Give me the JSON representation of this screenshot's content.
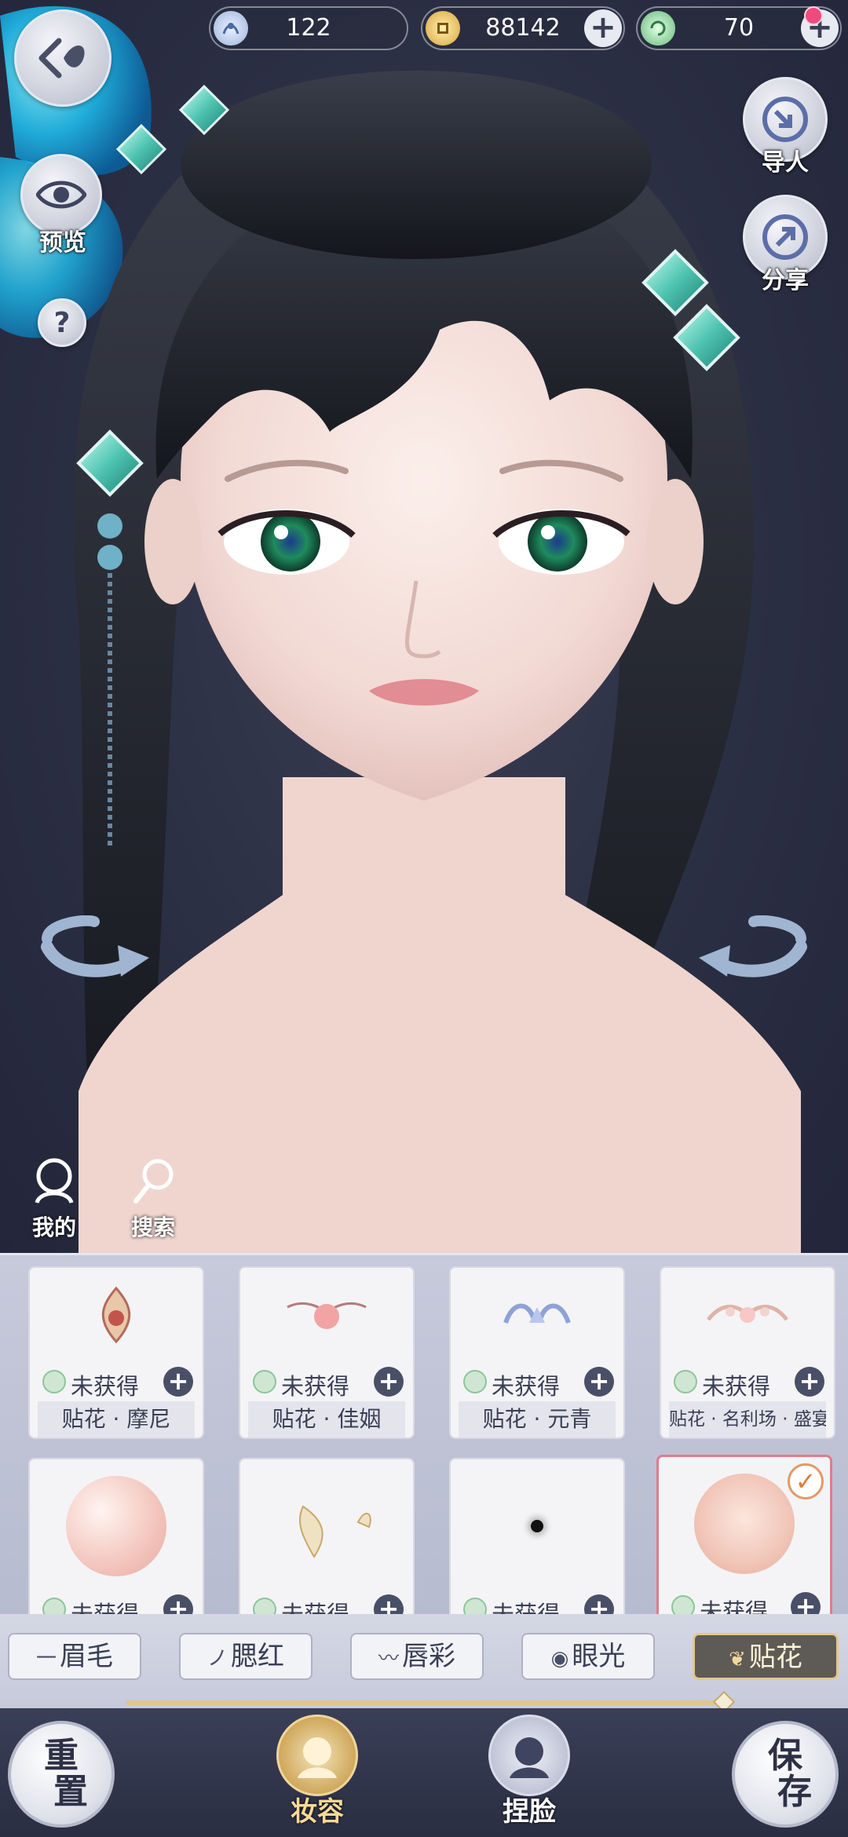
{
  "currency": {
    "jade": {
      "icon": "jade-coin-icon",
      "value": "122"
    },
    "coin": {
      "icon": "copper-coin-icon",
      "value": "88142"
    },
    "energy": {
      "icon": "spiral-token-icon",
      "value": "70"
    }
  },
  "side": {
    "preview_label": "预览",
    "import_label": "导人",
    "share_label": "分享",
    "help_label": "?",
    "mine_label": "我的",
    "search_label": "搜索"
  },
  "cards": [
    {
      "status": "未获得",
      "name": "贴花 · 摩尼"
    },
    {
      "status": "未获得",
      "name": "贴花 · 佳姻"
    },
    {
      "status": "未获得",
      "name": "贴花 · 元青"
    },
    {
      "status": "未获得",
      "name": "贴花 · 名利场 · 盛宴"
    },
    {
      "status": "未获得",
      "name": ""
    },
    {
      "status": "未获得",
      "name": ""
    },
    {
      "status": "未获得",
      "name": ""
    },
    {
      "status": "未获得",
      "name": ""
    }
  ],
  "tabs": [
    {
      "icon": "一",
      "label": "眉毛"
    },
    {
      "icon": "ノ",
      "label": "腮红"
    },
    {
      "icon": "〰",
      "label": "唇彩"
    },
    {
      "icon": "◉",
      "label": "眼光"
    },
    {
      "icon": "❦",
      "label": "贴花"
    }
  ],
  "bottom": {
    "reset": [
      "重",
      "置"
    ],
    "save": [
      "保",
      "存"
    ],
    "makeup_label": "妆容",
    "face_label": "捏脸"
  },
  "colors": {
    "accent_gold": "#e3c88a",
    "selected_border": "#e27b8b",
    "background": "#2d3146"
  }
}
